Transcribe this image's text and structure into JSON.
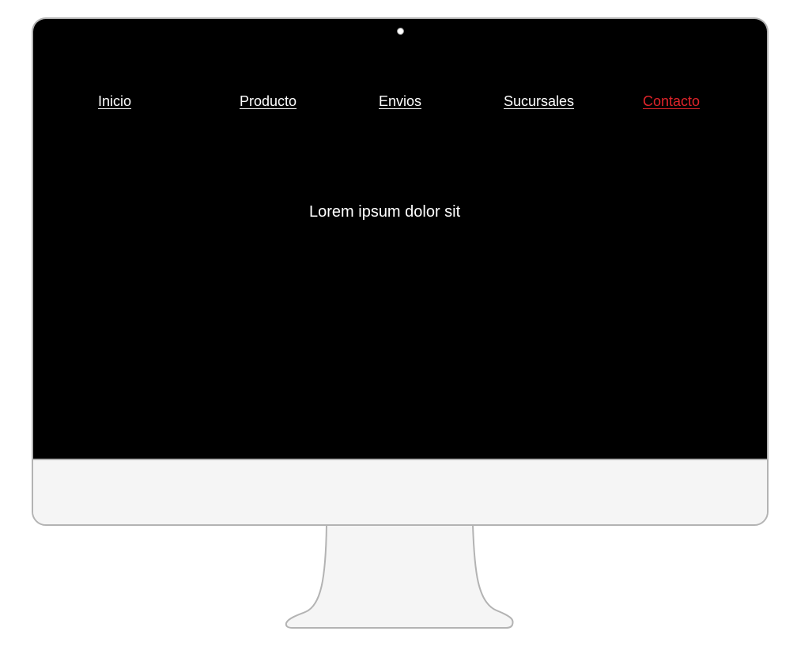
{
  "nav": {
    "items": [
      {
        "label": "Inicio"
      },
      {
        "label": "Producto"
      },
      {
        "label": "Envios"
      },
      {
        "label": "Sucursales"
      },
      {
        "label": "Contacto"
      }
    ]
  },
  "hero": {
    "text": "Lorem ipsum dolor sit"
  },
  "colors": {
    "screen_background": "#000000",
    "nav_text": "#ffffff",
    "nav_active": "#e0242a",
    "monitor_frame": "#b3b3b3",
    "monitor_body": "#f5f5f5"
  }
}
